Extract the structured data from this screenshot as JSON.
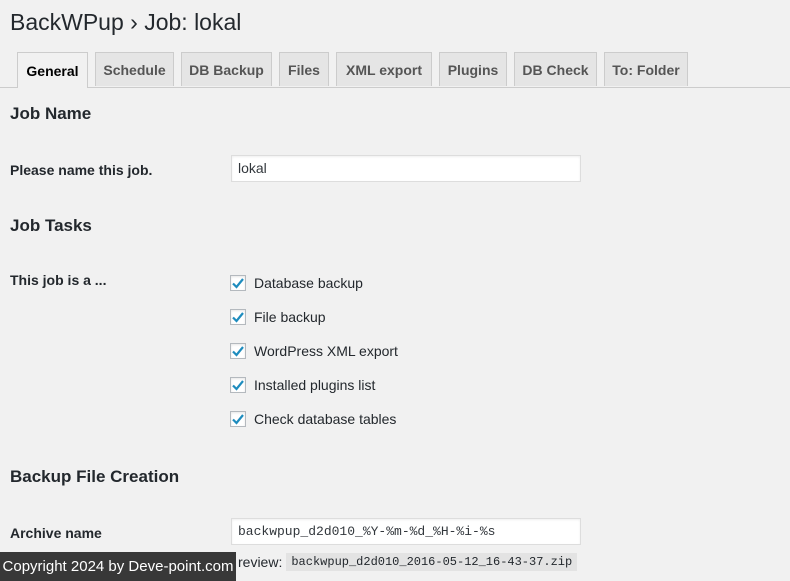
{
  "page": {
    "title": "BackWPup › Job: lokal"
  },
  "tabs": [
    {
      "label": "General",
      "active": true
    },
    {
      "label": "Schedule",
      "active": false
    },
    {
      "label": "DB Backup",
      "active": false
    },
    {
      "label": "Files",
      "active": false
    },
    {
      "label": "XML export",
      "active": false
    },
    {
      "label": "Plugins",
      "active": false
    },
    {
      "label": "DB Check",
      "active": false
    },
    {
      "label": "To: Folder",
      "active": false
    }
  ],
  "job_name": {
    "heading": "Job Name",
    "label": "Please name this job.",
    "value": "lokal"
  },
  "job_tasks": {
    "heading": "Job Tasks",
    "label": "This job is a ...",
    "options": [
      {
        "label": "Database backup",
        "checked": true
      },
      {
        "label": "File backup",
        "checked": true
      },
      {
        "label": "WordPress XML export",
        "checked": true
      },
      {
        "label": "Installed plugins list",
        "checked": true
      },
      {
        "label": "Check database tables",
        "checked": true
      }
    ]
  },
  "backup_file": {
    "heading": "Backup File Creation",
    "archive_label": "Archive name",
    "archive_value": "backwpup_d2d010_%Y-%m-%d_%H-%i-%s",
    "preview_label": "review:",
    "preview_value": "backwpup_d2d010_2016-05-12_16-43-37.zip"
  },
  "watermark": {
    "text": "Copyright 2024 by Deve-point.com"
  },
  "colors": {
    "background": "#f1f1f1",
    "checkmark": "#1e8cbe",
    "tab_inactive": "#e5e5e5"
  }
}
